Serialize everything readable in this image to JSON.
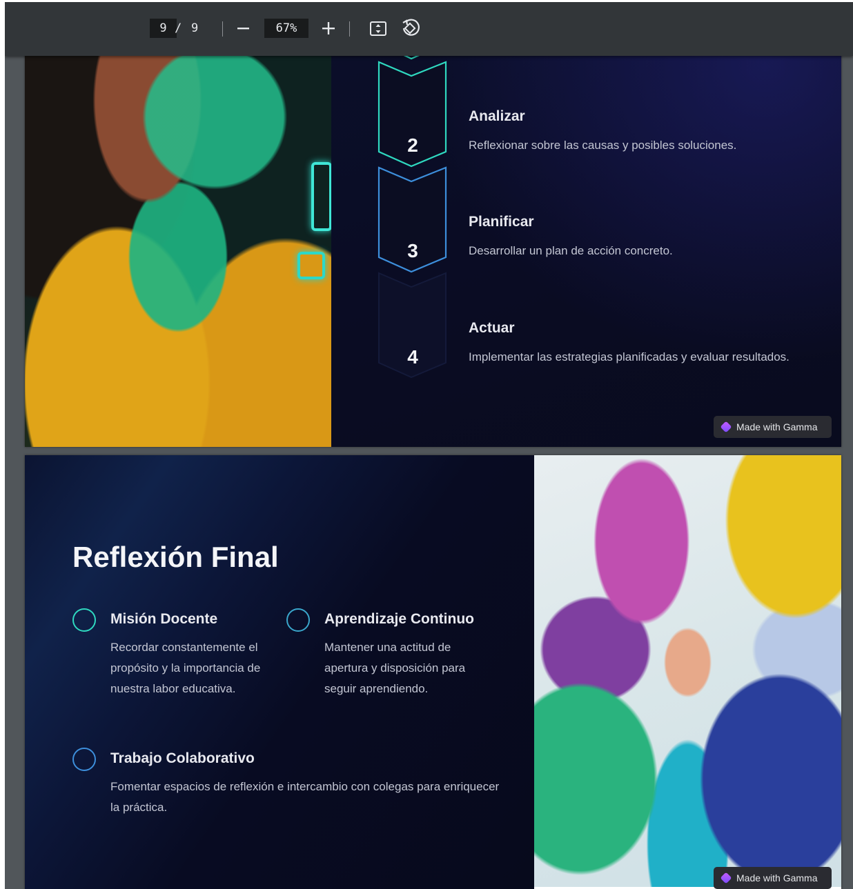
{
  "toolbar": {
    "current_page": "9",
    "page_separator": "/",
    "total_pages": "9",
    "zoom_level": "67%"
  },
  "slide_top": {
    "steps": [
      {
        "number": "2",
        "title": "Analizar",
        "description": "Reflexionar sobre las causas y posibles soluciones."
      },
      {
        "number": "3",
        "title": "Planificar",
        "description": "Desarrollar un plan de acción concreto."
      },
      {
        "number": "4",
        "title": "Actuar",
        "description": "Implementar las estrategias planificadas y evaluar resultados."
      }
    ],
    "badge": "Made with Gamma"
  },
  "slide_bottom": {
    "title": "Reflexión Final",
    "items": [
      {
        "title": "Misión Docente",
        "description": "Recordar constantemente el propósito y la importancia de nuestra labor educativa."
      },
      {
        "title": "Aprendizaje Continuo",
        "description": "Mantener una actitud de apertura y disposición para seguir aprendiendo."
      },
      {
        "title": "Trabajo Colaborativo",
        "description": "Fomentar espacios de reflexión e intercambio con colegas para enriquecer la práctica."
      }
    ],
    "badge": "Made with Gamma"
  },
  "colors": {
    "toolbar_bg": "#323639",
    "viewer_bg": "#51565a",
    "slide_bg": "#070a1c",
    "teal_accent": "#2fd9c0",
    "blue_accent": "#3d8fdc"
  }
}
